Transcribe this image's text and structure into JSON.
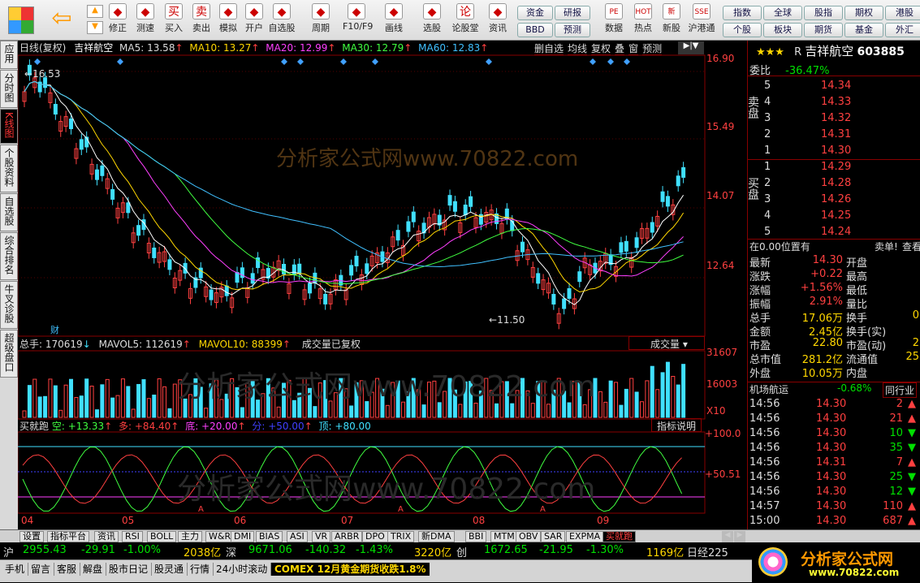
{
  "toolbar": {
    "left_buttons": [
      {
        "label": "修正",
        "icon": "refresh-icon"
      },
      {
        "label": "测速",
        "icon": "clock-icon"
      },
      {
        "label": "买入",
        "icon": "buy-icon",
        "glyph": "买"
      },
      {
        "label": "卖出",
        "icon": "sell-icon",
        "glyph": "卖"
      },
      {
        "label": "模拟",
        "icon": "hammer-icon"
      },
      {
        "label": "开户",
        "icon": "lock-icon"
      },
      {
        "label": "自选股",
        "icon": "star-icon"
      },
      {
        "label": "周期",
        "icon": "cycle-icon"
      },
      {
        "label": "F10/F9",
        "icon": "doc-icon"
      },
      {
        "label": "画线",
        "icon": "pen-icon"
      },
      {
        "label": "选股",
        "icon": "screen-icon"
      },
      {
        "label": "论股堂",
        "icon": "discuss-icon",
        "glyph": "论"
      },
      {
        "label": "资讯",
        "icon": "info-icon"
      }
    ],
    "mid_buttons": [
      "资金",
      "研报",
      "BBD",
      "预测"
    ],
    "right_icons": [
      {
        "label": "数据",
        "glyph": "PE"
      },
      {
        "label": "热点",
        "glyph": "HOT"
      },
      {
        "label": "新股",
        "glyph": "新"
      },
      {
        "label": "沪港通",
        "glyph": "SSE"
      }
    ],
    "far_right": [
      "指数",
      "全球",
      "股指",
      "期权",
      "港股",
      "个股",
      "板块",
      "期货",
      "基金",
      "外汇"
    ]
  },
  "left_tabs": [
    "应用",
    "分时图",
    "K线图",
    "个股资料",
    "自选股",
    "综合排名",
    "牛叉诊股",
    "超级盘口"
  ],
  "chart": {
    "header": {
      "period": "日线(复权)",
      "name": "吉祥航空",
      "ma5": "MA5: 13.58",
      "ma10": "MA10: 13.27",
      "ma20": "MA20: 12.99",
      "ma30": "MA30: 12.79",
      "ma60": "MA60: 12.83"
    },
    "top_buttons": [
      "删自选",
      "均线",
      "复权",
      "叠",
      "窗",
      "预测"
    ],
    "y_ticks": [
      "16.90",
      "15.49",
      "14.07",
      "12.64"
    ],
    "high_label": "16.53",
    "low_label": "11.50",
    "cai_label": "财",
    "watermark": "分析家公式网www.70822.com",
    "volume_header": {
      "total": "总手: 170619",
      "mavol5": "MAVOL5: 112619",
      "mavol10": "MAVOL10: 88399",
      "note": "成交量已复权"
    },
    "volume_dropdown": "成交量",
    "volume_ticks": [
      "31607",
      "16003",
      "X10"
    ],
    "ind_header": {
      "name": "买就跑",
      "kong": "空: +13.33",
      "duo": "多: +84.40",
      "di": "底: +20.00",
      "fen": "分: +50.00",
      "ding": "顶: +80.00"
    },
    "ind_button": "指标说明",
    "ind_ticks": [
      "100.0",
      "50.51"
    ],
    "x_labels": [
      "04",
      "05",
      "06",
      "07",
      "08",
      "09"
    ]
  },
  "chart_data": {
    "type": "candlestick",
    "title": "",
    "y_ticks": [
      16.9,
      15.49,
      14.07,
      12.64
    ],
    "high": 16.53,
    "low": 11.5,
    "ma": {
      "MA5": 13.58,
      "MA10": 13.27,
      "MA20": 12.99,
      "MA30": 12.79,
      "MA60": 12.83
    },
    "volume": {
      "total": 170619,
      "MAVOL5": 112619,
      "MAVOL10": 88399
    },
    "indicator": {
      "空": 13.33,
      "多": 84.4,
      "底": 20.0,
      "分": 50.0,
      "顶": 80.0
    },
    "x_labels": [
      "04",
      "05",
      "06",
      "07",
      "08",
      "09"
    ]
  },
  "quote": {
    "stars": "★★★",
    "flag": "R",
    "name": "吉祥航空",
    "code": "603885",
    "weibi_label": "委比",
    "weibi": "-36.47%",
    "sell": [
      {
        "n": "5",
        "p": "14.34"
      },
      {
        "n": "4",
        "p": "14.33"
      },
      {
        "n": "3",
        "p": "14.32"
      },
      {
        "n": "2",
        "p": "14.31"
      },
      {
        "n": "1",
        "p": "14.30"
      }
    ],
    "buy": [
      {
        "n": "1",
        "p": "14.29"
      },
      {
        "n": "2",
        "p": "14.28"
      },
      {
        "n": "3",
        "p": "14.26"
      },
      {
        "n": "4",
        "p": "14.25"
      },
      {
        "n": "5",
        "p": "14.24"
      }
    ],
    "sell_label": "卖盘",
    "buy_label": "买盘",
    "pos": "在0.00位置有",
    "sell_buy": "卖单!",
    "query": "查看",
    "stats": [
      [
        "最新",
        "14.30",
        "开盘"
      ],
      [
        "涨跌",
        "+0.22",
        "最高"
      ],
      [
        "涨幅",
        "+1.56%",
        "最低"
      ],
      [
        "振幅",
        "2.91%",
        "量比"
      ],
      [
        "总手",
        "17.06万",
        "换手"
      ],
      [
        "金额",
        "2.45亿",
        "换手(实)"
      ],
      [
        "市盈",
        "22.80",
        "市盈(动)"
      ],
      [
        "总市值",
        "281.2亿",
        "流通值"
      ],
      [
        "外盘",
        "10.05万",
        "内盘"
      ]
    ],
    "stats_right": [
      "",
      "",
      "",
      "",
      "0",
      "",
      "2",
      "25",
      ""
    ],
    "sector": "机场航运",
    "sector_pct": "-0.68%",
    "sector_btn": "同行业",
    "ticks": [
      [
        "14:56",
        "14.30",
        "2",
        "up"
      ],
      [
        "14:56",
        "14.30",
        "21",
        "up"
      ],
      [
        "14:56",
        "14.30",
        "10",
        "down"
      ],
      [
        "14:56",
        "14.30",
        "35",
        "down"
      ],
      [
        "14:56",
        "14.31",
        "7",
        "up"
      ],
      [
        "14:56",
        "14.30",
        "25",
        "down"
      ],
      [
        "14:56",
        "14.30",
        "12",
        "down"
      ],
      [
        "14:57",
        "14.30",
        "110",
        "up"
      ],
      [
        "15:00",
        "14.30",
        "687",
        "up"
      ]
    ]
  },
  "bottom_tabs": [
    "设置",
    "指标平台",
    "资讯",
    "RSI",
    "BOLL",
    "主力",
    "W&R",
    "DMI",
    "BIAS",
    "ASI",
    "VR",
    "ARBR",
    "DPO",
    "TRIX",
    "新DMA",
    "BBI",
    "MTM",
    "OBV",
    "SAR",
    "EXPMA",
    "买就跑"
  ],
  "ticker": {
    "sh": "沪",
    "sh_val": "2955.43",
    "sh_chg": "-29.91",
    "sh_pct": "-1.00%",
    "sh_amt": "2038亿",
    "sz": "深",
    "sz_val": "9671.06",
    "sz_chg": "-140.32",
    "sz_pct": "-1.43%",
    "sz_amt": "3220亿",
    "cy": "创",
    "cy_val": "1672.65",
    "cy_chg": "-21.95",
    "cy_pct": "-1.30%",
    "cy_amt": "1169亿",
    "nk": "日经225"
  },
  "status": {
    "items": [
      "手机",
      "留言",
      "客服",
      "解盘",
      "股市日记",
      "股灵通",
      "行情",
      "24小时滚动"
    ],
    "news": "COMEX 12月黄金期货收跌1.8%",
    "logo": "分析家公式网",
    "logo_url": "www.70822.com"
  }
}
